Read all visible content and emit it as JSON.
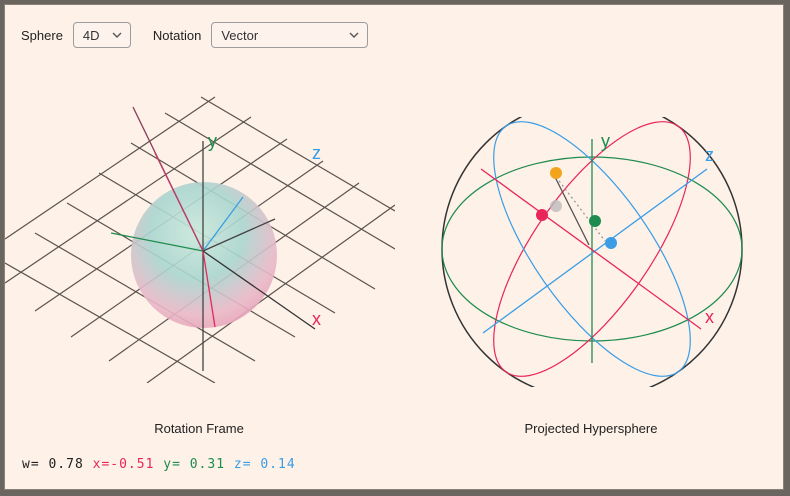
{
  "toolbar": {
    "sphere_label": "Sphere",
    "sphere_value": "4D",
    "notation_label": "Notation",
    "notation_value": "Vector"
  },
  "left": {
    "caption": "Rotation Frame",
    "axes": {
      "x": "x",
      "y": "y",
      "z": "z"
    }
  },
  "right": {
    "caption": "Projected Hypersphere",
    "axes": {
      "x": "x",
      "y": "y",
      "z": "z"
    }
  },
  "readout": {
    "w_label": "w=",
    "w_value": "0.78",
    "x_label": "x=",
    "x_value": "-0.51",
    "y_label": "y=",
    "y_value": "0.31",
    "z_label": "z=",
    "z_value": "0.14"
  },
  "colors": {
    "x": "#e8265a",
    "y": "#1e8c4e",
    "z": "#3a9de6",
    "w": "#222222",
    "point_w": "#f2a41c",
    "grid": "#5a534d"
  }
}
